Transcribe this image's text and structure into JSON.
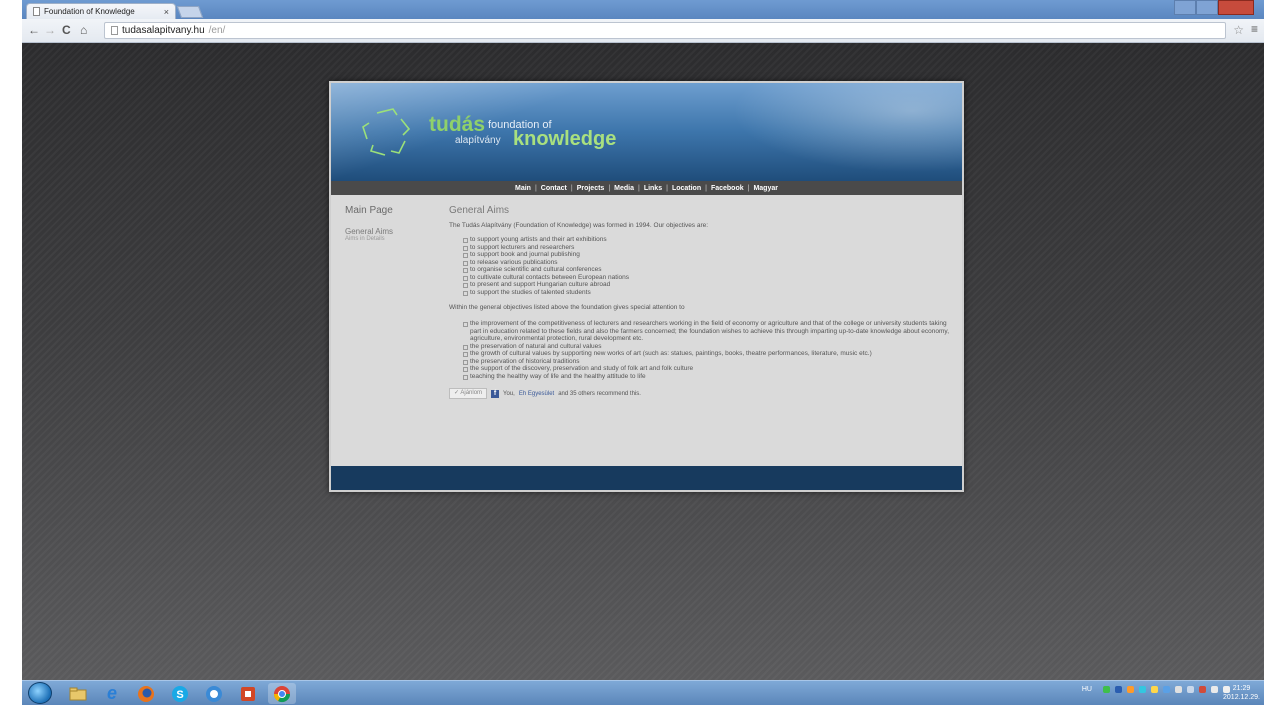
{
  "browser": {
    "tab_title": "Foundation of Knowledge",
    "tab_close": "×",
    "url_host": "tudasalapitvany.hu",
    "url_path": "/en/",
    "back": "←",
    "forward": "→",
    "reload": "C",
    "home": "⌂",
    "star": "☆",
    "menu": "≡"
  },
  "site": {
    "brand_tudas": "tudás",
    "brand_foundation": "foundation of",
    "brand_alapitvany": "alapítvány",
    "brand_knowledge": "knowledge",
    "nav": [
      "Main",
      "Contact",
      "Projects",
      "Media",
      "Links",
      "Location",
      "Facebook",
      "Magyar"
    ],
    "nav_separator": "|"
  },
  "sidebar": {
    "main_page": "Main Page",
    "general_aims": "General Aims",
    "aims_in_details": "Aims in Details"
  },
  "content": {
    "heading": "General Aims",
    "intro": "The Tudás Alapítvány (Foundation of Knowledge) was formed in 1994. Our objectives are:",
    "objectives": [
      "to support young artists and their art exhibitions",
      "to support lecturers and researchers",
      "to support book and journal publishing",
      "to release various publications",
      "to organise scientific and cultural conferences",
      "to cultivate cultural contacts between European nations",
      "to present and support Hungarian culture abroad",
      "to support the studies of talented students"
    ],
    "within": "Within the general objectives listed above the foundation gives special attention to",
    "special": [
      "the improvement of the competitiveness of lecturers and researchers working in the field of economy or agriculture and that of the college or university students taking part in education related to these fields and also the farmers concerned; the foundation wishes to achieve this through imparting up-to-date knowledge about economy, agriculture, environmental protection, rural development etc.",
      "the preservation of natural and cultural values",
      "the growth of cultural values by supporting new works of art (such as: statues, paintings, books, theatre performances, literature, music etc.)",
      "the preservation of historical traditions",
      "the support of the discovery, preservation and study of folk art and folk culture",
      "teaching the healthy way of life and the healthy attitude to life"
    ],
    "recommend_button": "✓ Ajánlom",
    "fb_icon_letter": "f",
    "recommend_you": "You,",
    "recommend_link": "Eh Egyesület",
    "recommend_rest": "and 35 others recommend this."
  },
  "taskbar": {
    "language": "HU",
    "time": "21:29",
    "date": "2012.12.29."
  }
}
